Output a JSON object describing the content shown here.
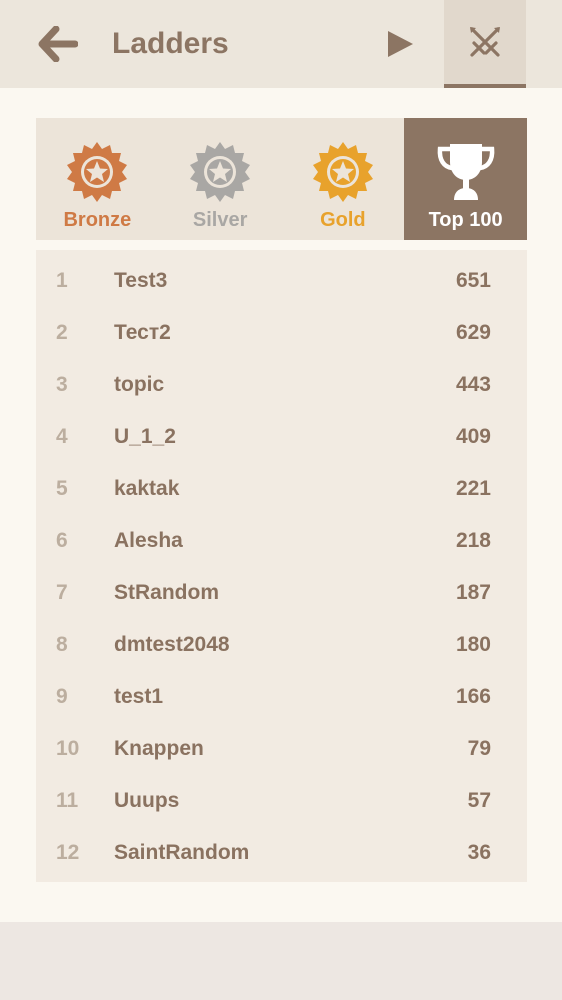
{
  "header": {
    "title": "Ladders",
    "back_icon": "arrow-left-icon",
    "play_icon": "play-icon",
    "battle_icon": "crossed-swords-icon"
  },
  "tabs": [
    {
      "label": "Bronze",
      "icon": "bronze-star-badge-icon",
      "color": "#cf7a45",
      "active": false
    },
    {
      "label": "Silver",
      "icon": "silver-star-badge-icon",
      "color": "#a9a7a4",
      "active": false
    },
    {
      "label": "Gold",
      "icon": "gold-star-badge-icon",
      "color": "#e8a22c",
      "active": false
    },
    {
      "label": "Top 100",
      "icon": "trophy-icon",
      "color": "#ffffff",
      "active": true
    }
  ],
  "ladder": {
    "rows": [
      {
        "rank": "1",
        "name": "Test3",
        "score": "651"
      },
      {
        "rank": "2",
        "name": "Тест2",
        "score": "629"
      },
      {
        "rank": "3",
        "name": "topic",
        "score": "443"
      },
      {
        "rank": "4",
        "name": "U_1_2",
        "score": "409"
      },
      {
        "rank": "5",
        "name": "kaktak",
        "score": "221"
      },
      {
        "rank": "6",
        "name": "Alesha",
        "score": "218"
      },
      {
        "rank": "7",
        "name": "StRandom",
        "score": "187"
      },
      {
        "rank": "8",
        "name": "dmtest2048",
        "score": "180"
      },
      {
        "rank": "9",
        "name": "test1",
        "score": "166"
      },
      {
        "rank": "10",
        "name": "Knappen",
        "score": "79"
      },
      {
        "rank": "11",
        "name": "Uuups",
        "score": "57"
      },
      {
        "rank": "12",
        "name": "SaintRandom",
        "score": "36"
      }
    ]
  },
  "colors": {
    "accent": "#8c7563",
    "background": "#fbf8f1",
    "header_bg": "#ece6dc"
  }
}
